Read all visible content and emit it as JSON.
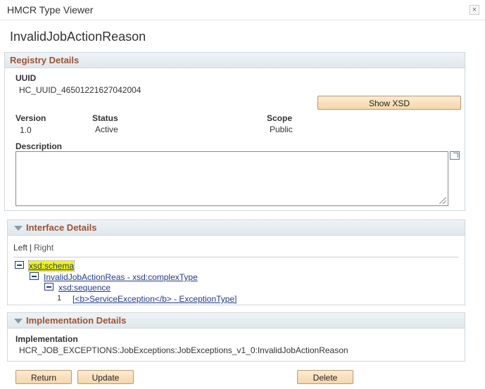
{
  "window": {
    "title": "HMCR Type Viewer",
    "close_glyph": "×"
  },
  "page": {
    "title": "InvalidJobActionReason"
  },
  "registry": {
    "header": "Registry Details",
    "uuid_label": "UUID",
    "uuid_value": "HC_UUID_46501221627042004",
    "show_xsd_label": "Show XSD",
    "version_label": "Version",
    "version_value": "1.0",
    "status_label": "Status",
    "status_value": "Active",
    "scope_label": "Scope",
    "scope_value": "Public",
    "description_label": "Description",
    "description_value": ""
  },
  "interface": {
    "header": "Interface Details",
    "tabs": {
      "left": "Left",
      "sep": "|",
      "right": "Right"
    },
    "tree": {
      "schema": "xsd:schema",
      "complex_type": "InvalidJobActionReas - xsd:complexType",
      "sequence": "xsd:sequence",
      "element_index": "1",
      "element": "[<b>ServiceException</b> - ExceptionType]"
    }
  },
  "implementation": {
    "header": "Implementation Details",
    "label": "Implementation",
    "value": "HCR_JOB_EXCEPTIONS:JobExceptions:JobExceptions_v1_0:InvalidJobActionReason"
  },
  "actions": {
    "return_label": "Return",
    "update_label": "Update",
    "delete_label": "Delete"
  }
}
